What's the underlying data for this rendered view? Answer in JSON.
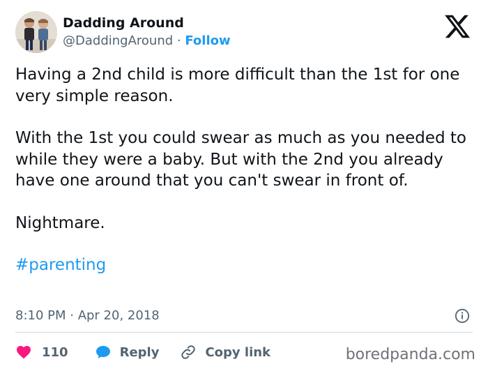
{
  "author": {
    "name": "Dadding Around",
    "handle": "@DaddingAround",
    "separator": "·",
    "follow_label": "Follow"
  },
  "tweet": {
    "paragraphs": [
      "Having a 2nd child is more difficult than the 1st for one very simple reason.",
      "With the 1st you could swear as much as you needed to while they were a baby. But with the 2nd you already have one around that you can't swear in front of.",
      "Nightmare."
    ],
    "hashtag": "#parenting",
    "timestamp": "8:10 PM · Apr 20, 2018"
  },
  "actions": {
    "likes": "110",
    "reply_label": "Reply",
    "copy_label": "Copy link"
  },
  "watermark": "boredpanda.com",
  "icons": {
    "like": "heart-icon",
    "reply": "speech-bubble-icon",
    "copy": "link-icon",
    "info": "info-icon",
    "logo": "x-logo-icon"
  },
  "colors": {
    "accent": "#1d9bf0",
    "like": "#f91880",
    "text": "#0f1419",
    "muted": "#536471"
  }
}
